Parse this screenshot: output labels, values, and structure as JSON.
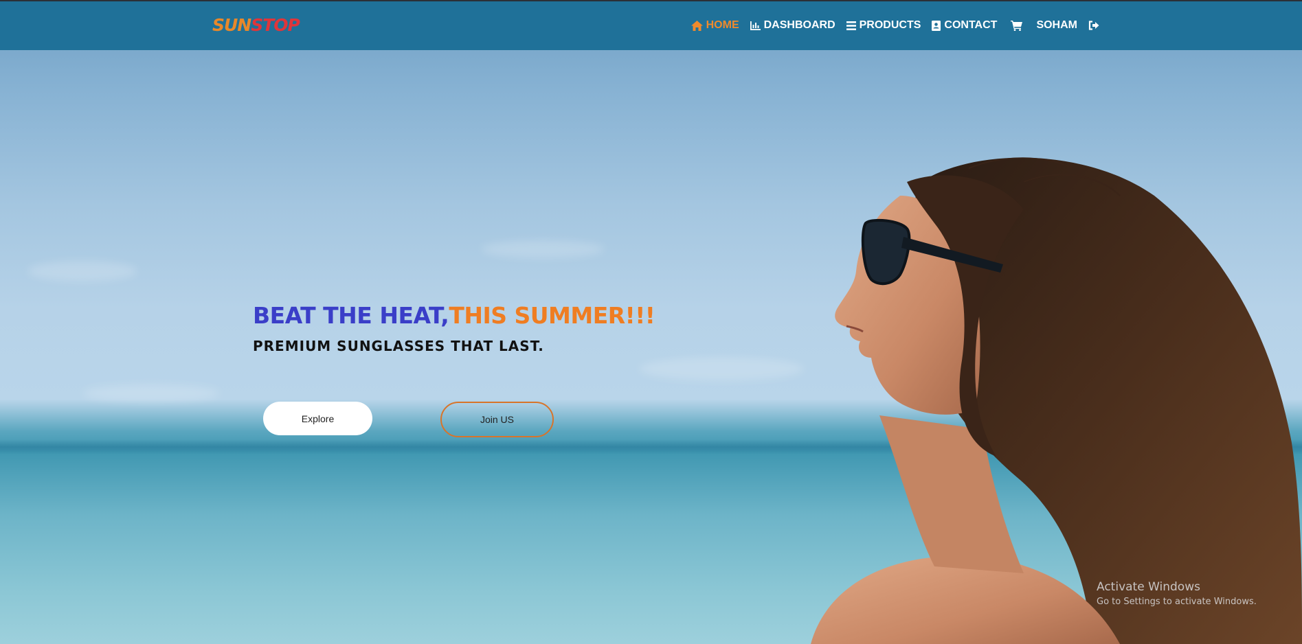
{
  "brand": {
    "logo_part1": "SUN",
    "logo_part2": "STOP",
    "logo_colors": {
      "part1": "#e9882a",
      "part2": "#e0353a"
    }
  },
  "nav": {
    "items": [
      {
        "label": "HOME",
        "icon": "home-icon",
        "active": true
      },
      {
        "label": "DASHBOARD",
        "icon": "bar-chart-icon",
        "active": false
      },
      {
        "label": "PRODUCTS",
        "icon": "list-icon",
        "active": false
      },
      {
        "label": "CONTACT",
        "icon": "contact-card-icon",
        "active": false
      },
      {
        "label": "",
        "icon": "cart-icon",
        "active": false
      },
      {
        "label": "SOHAM",
        "icon": "",
        "active": false
      },
      {
        "label": "",
        "icon": "sign-out-icon",
        "active": false
      }
    ],
    "colors": {
      "background": "#1f7199",
      "active": "#f08a2c",
      "text": "#ffffff"
    }
  },
  "hero": {
    "headline_part1": "BEAT THE HEAT,",
    "headline_part2": "THIS SUMMER!!!",
    "subheadline": "PREMIUM SUNGLASSES THAT LAST.",
    "headline_colors": {
      "part1": "#3a3ec8",
      "part2": "#ef7d22"
    },
    "buttons": {
      "explore": "Explore",
      "join": "Join US"
    }
  },
  "os_watermark": {
    "title": "Activate Windows",
    "subtitle": "Go to Settings to activate Windows."
  }
}
